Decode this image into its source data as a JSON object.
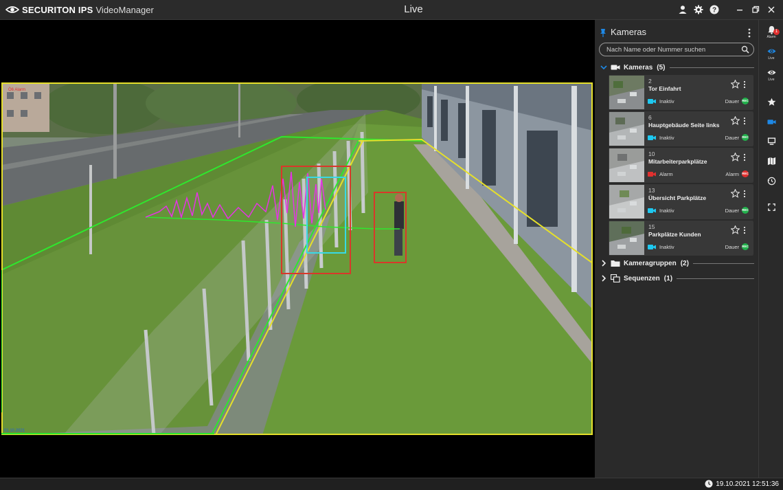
{
  "app": {
    "brand": "SECURITON IPS",
    "product": "VideoManager",
    "view_title": "Live"
  },
  "titlebar_icons": [
    "user-icon",
    "gear-icon",
    "help-icon",
    "minimize-icon",
    "restore-icon",
    "close-icon"
  ],
  "video": {
    "overlay_top_left": "Ö6 Alarm",
    "overlay_bottom_left": "01.10.2021"
  },
  "panel": {
    "title": "Kameras",
    "search_placeholder": "Nach Name oder Nummer suchen",
    "groups": [
      {
        "label": "Kameras",
        "count": "(5)",
        "expanded": true
      },
      {
        "label": "Kameragruppen",
        "count": "(2)",
        "expanded": false
      },
      {
        "label": "Sequenzen",
        "count": "(1)",
        "expanded": false
      }
    ],
    "cameras": [
      {
        "number": "2",
        "name": "Tor Einfahrt",
        "status": "Inaktiv",
        "mode": "Dauer",
        "dot_label": "REC",
        "status_color": "#1ec8f0",
        "dot_color": "#22b14c"
      },
      {
        "number": "6",
        "name": "Hauptgebäude Seite links",
        "status": "Inaktiv",
        "mode": "Dauer",
        "dot_label": "REC",
        "status_color": "#1ec8f0",
        "dot_color": "#22b14c"
      },
      {
        "number": "10",
        "name": "Mitarbeiterparkplätze",
        "status": "Alarm",
        "mode": "Alarm",
        "dot_label": "REC",
        "status_color": "#e0302f",
        "dot_color": "#e0302f"
      },
      {
        "number": "13",
        "name": "Übersicht Parkplätze",
        "status": "Inaktiv",
        "mode": "Dauer",
        "dot_label": "REC",
        "status_color": "#1ec8f0",
        "dot_color": "#22b14c"
      },
      {
        "number": "15",
        "name": "Parkplätze Kunden",
        "status": "Inaktiv",
        "mode": "Dauer",
        "dot_label": "REC",
        "status_color": "#1ec8f0",
        "dot_color": "#22b14c"
      }
    ]
  },
  "rail": {
    "alarm_label": "Alarm",
    "alarm_badge": "1",
    "live_label_1": "Live",
    "live_label_2": "Live"
  },
  "status": {
    "datetime": "19.10.2021 12:51:36"
  },
  "colors": {
    "accent": "#1e88e5",
    "panel_bg": "#2a2a2a",
    "card_bg": "#383838",
    "rec_green": "#22b14c",
    "alarm_red": "#e0302f"
  }
}
